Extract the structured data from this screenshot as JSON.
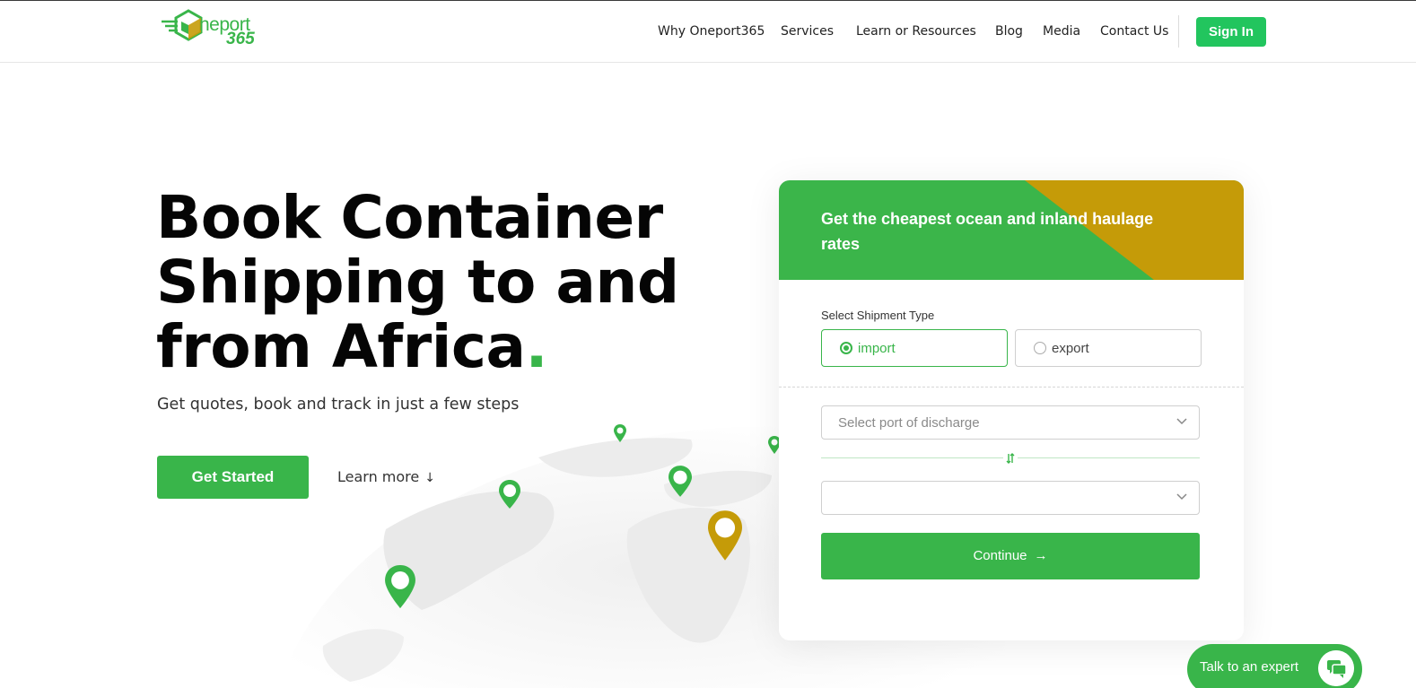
{
  "brand": {
    "logo_word": "neport",
    "logo_number": "365",
    "primary_color": "#39b54a",
    "accent_color": "#c59b08",
    "signin_color": "#22c55e"
  },
  "nav": {
    "items": [
      {
        "label": "Why Oneport365"
      },
      {
        "label": "Services"
      },
      {
        "label": "Learn or Resources"
      },
      {
        "label": "Blog"
      },
      {
        "label": "Media"
      },
      {
        "label": "Contact Us"
      }
    ],
    "signin_label": "Sign In"
  },
  "hero": {
    "title_line1": "Book Container",
    "title_line2": "Shipping to and",
    "title_line3": "from Africa",
    "title_dot": ".",
    "subtitle": "Get quotes, book and track in just a few steps",
    "get_started_label": "Get Started",
    "learn_more_label": "Learn more",
    "learn_more_arrow": "↓"
  },
  "quote_form": {
    "heading": "Get the cheapest ocean and inland haulage rates",
    "shipment_type_label": "Select Shipment Type",
    "options": [
      {
        "label": "import",
        "selected": true
      },
      {
        "label": "export",
        "selected": false
      }
    ],
    "port_select_placeholder": "Select port of discharge",
    "second_select_value": "",
    "swap_icon": "swap-arrows-icon",
    "continue_label": "Continue",
    "continue_arrow": "→"
  },
  "chat": {
    "label": "Talk to an expert",
    "icon": "chat-bubbles-icon"
  }
}
